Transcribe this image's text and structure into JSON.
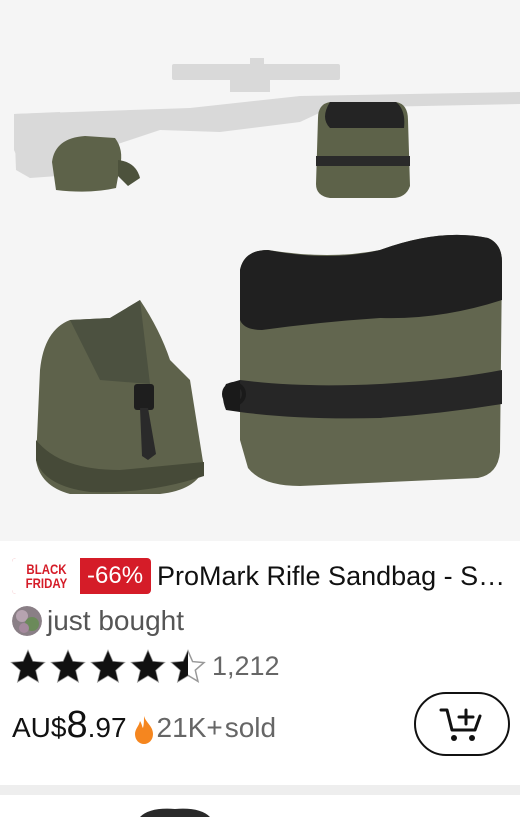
{
  "product": {
    "promo_line1": "BLACK",
    "promo_line2": "FRIDAY",
    "discount": "-66%",
    "title": "ProMark Rifle Sandbag - Shooting Rest Bags Front & Rear Set",
    "social_proof": "just bought",
    "rating": 4.5,
    "rating_max": 5,
    "review_count": "1,212",
    "currency": "AU$",
    "price_integer": "8",
    "price_decimal": ".97",
    "sold_count": "21K+",
    "sold_label": "sold"
  },
  "icons": {
    "star": "star-icon",
    "fire": "fire-icon",
    "cart": "add-to-cart-icon"
  },
  "colors": {
    "badge_red": "#d51c28",
    "fire_orange": "#f5861f",
    "bag_olive": "#5a5e48",
    "bag_black": "#1e1e1e"
  }
}
